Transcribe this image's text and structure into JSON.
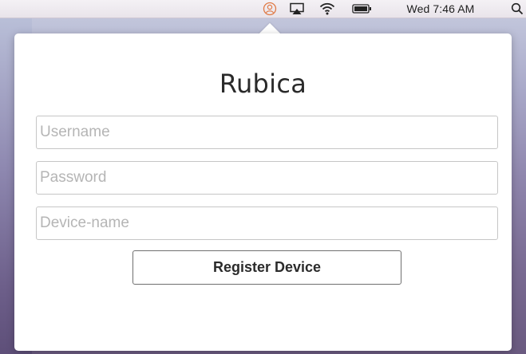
{
  "menubar": {
    "clock": "Wed 7:46 AM",
    "icons": [
      "rubica-status-icon",
      "airplay-icon",
      "wifi-icon",
      "battery-icon",
      "spotlight-search-icon"
    ]
  },
  "popover": {
    "title": "Rubica",
    "username_placeholder": "Username",
    "password_placeholder": "Password",
    "device_placeholder": "Device-name",
    "username_value": "",
    "password_value": "",
    "device_value": "",
    "register_label": "Register Device"
  },
  "colors": {
    "accent_orange": "#e07a45",
    "menubar_bg": "#efebf0",
    "field_border": "#c6c6c6",
    "placeholder": "#b5b5b5"
  }
}
